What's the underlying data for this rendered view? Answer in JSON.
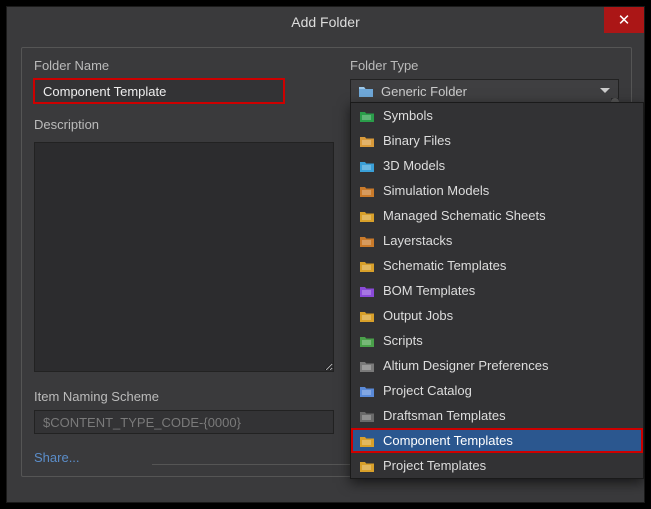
{
  "dialog": {
    "title": "Add Folder"
  },
  "labels": {
    "folderName": "Folder Name",
    "folderType": "Folder Type",
    "description": "Description",
    "namingScheme": "Item Naming Scheme"
  },
  "fields": {
    "folderName": "Component Template",
    "description": "",
    "namingScheme": "$CONTENT_TYPE_CODE-{0000}"
  },
  "folderType": {
    "selected": "Generic Folder",
    "selectedIcon": "folder-icon",
    "options": [
      {
        "label": "Symbols",
        "icon": "symbols-icon",
        "selected": false
      },
      {
        "label": "Binary Files",
        "icon": "binary-icon",
        "selected": false
      },
      {
        "label": "3D Models",
        "icon": "models3d-icon",
        "selected": false
      },
      {
        "label": "Simulation Models",
        "icon": "sim-icon",
        "selected": false
      },
      {
        "label": "Managed Schematic Sheets",
        "icon": "schematic-icon",
        "selected": false
      },
      {
        "label": "Layerstacks",
        "icon": "layerstacks-icon",
        "selected": false
      },
      {
        "label": "Schematic Templates",
        "icon": "schtpl-icon",
        "selected": false
      },
      {
        "label": "BOM Templates",
        "icon": "bom-icon",
        "selected": false
      },
      {
        "label": "Output Jobs",
        "icon": "output-icon",
        "selected": false
      },
      {
        "label": "Scripts",
        "icon": "scripts-icon",
        "selected": false
      },
      {
        "label": "Altium Designer Preferences",
        "icon": "prefs-icon",
        "selected": false
      },
      {
        "label": "Project Catalog",
        "icon": "catalog-icon",
        "selected": false
      },
      {
        "label": "Draftsman Templates",
        "icon": "draftsman-icon",
        "selected": false
      },
      {
        "label": "Component Templates",
        "icon": "comptpl-icon",
        "selected": true,
        "highlighted": true
      },
      {
        "label": "Project Templates",
        "icon": "projtpl-icon",
        "selected": false
      }
    ]
  },
  "links": {
    "share": "Share..."
  },
  "iconColors": {
    "folder-icon": "#6fa8d8",
    "symbols-icon": "#2a9d4a",
    "binary-icon": "#d89a3a",
    "models3d-icon": "#3aa0d8",
    "sim-icon": "#c97a2a",
    "schematic-icon": "#d8a02a",
    "layerstacks-icon": "#c97a2a",
    "schtpl-icon": "#d8a02a",
    "bom-icon": "#8a4ad8",
    "output-icon": "#d8a02a",
    "scripts-icon": "#4aa04a",
    "prefs-icon": "#7a7a7a",
    "catalog-icon": "#5a8ad8",
    "draftsman-icon": "#6a6a6a",
    "comptpl-icon": "#d8a02a",
    "projtpl-icon": "#d8a02a"
  }
}
